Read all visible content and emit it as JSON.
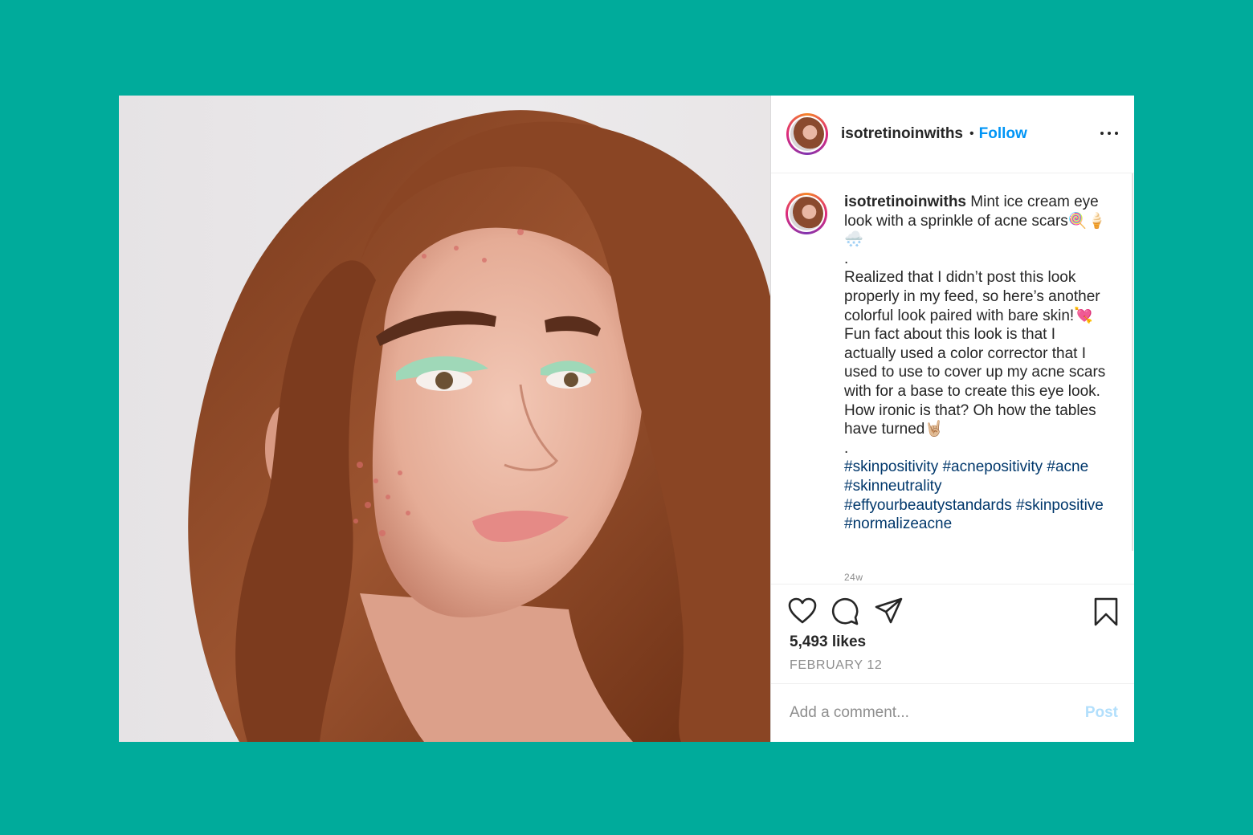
{
  "colors": {
    "background": "#00ab9b",
    "follow_blue": "#0095f6",
    "hashtag_blue": "#00376b",
    "post_disabled": "#b2dffc"
  },
  "header": {
    "username": "isotretinoinwiths",
    "separator": "•",
    "follow_label": "Follow",
    "more_icon": "more-horizontal-icon"
  },
  "caption": {
    "username": "isotretinoinwiths",
    "line1": "Mint ice cream eye look with a sprinkle of acne scars🍭🍦🌨️",
    "dot1": ".",
    "body": "Realized that I didn’t post this look properly in my feed, so here’s another colorful look paired with bare skin!💘Fun fact about this look is that I actually used a color corrector that I used to use to cover up my acne scars with for a base to create this eye look. How ironic is that? Oh how the tables have turned🤘🏼",
    "dot2": ".",
    "hashtags": "#skinpositivity #acnepositivity #acne #skinneutrality #effyourbeautystandards #skinpositive #normalizeacne",
    "timestamp": "24w"
  },
  "actions": {
    "icons": [
      "heart-icon",
      "comment-icon",
      "share-icon",
      "bookmark-icon"
    ]
  },
  "likes": "5,493 likes",
  "date": "FEBRUARY 12",
  "comment": {
    "placeholder": "Add a comment...",
    "post_label": "Post"
  }
}
